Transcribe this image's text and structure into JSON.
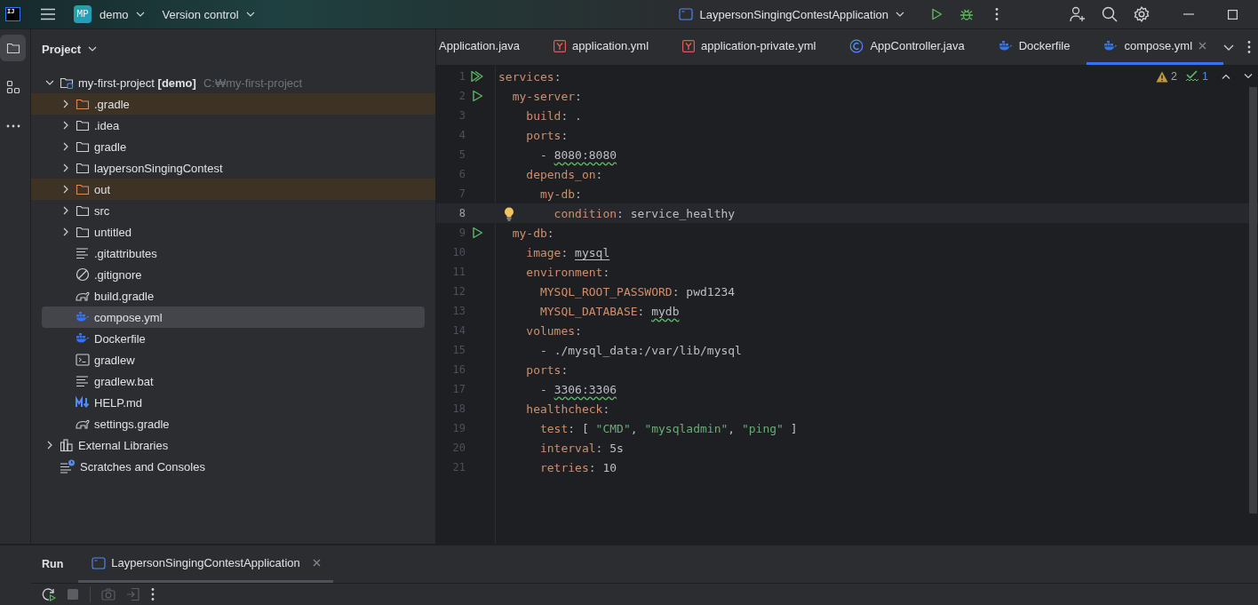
{
  "title_bar": {
    "app_logo": "IJ",
    "project_badge": "MP",
    "project_name": "demo",
    "vcs_menu": "Version control",
    "run_config": "LaypersonSingingContestApplication"
  },
  "tool_strip": [
    {
      "kind": "project",
      "selected": true
    },
    {
      "kind": "structure",
      "selected": false
    },
    {
      "kind": "more",
      "selected": false
    }
  ],
  "project_panel": {
    "title": "Project",
    "tree": [
      {
        "kind": "project",
        "label": "my-first-project **[demo]**",
        "path": "C:₩my-first-project",
        "expanded": true,
        "excluded": false,
        "selected": false,
        "children": [
          {
            "kind": "folder",
            "label": ".gradle",
            "expanded": false,
            "excluded": true,
            "selected": false
          },
          {
            "kind": "folder",
            "label": ".idea",
            "expanded": false,
            "excluded": false,
            "selected": false
          },
          {
            "kind": "folder",
            "label": "gradle",
            "expanded": false,
            "excluded": false,
            "selected": false
          },
          {
            "kind": "folder",
            "label": "laypersonSingingContest",
            "expanded": false,
            "excluded": false,
            "selected": false
          },
          {
            "kind": "folder",
            "label": "out",
            "expanded": false,
            "excluded": true,
            "selected": false
          },
          {
            "kind": "folder",
            "label": "src",
            "expanded": false,
            "excluded": false,
            "selected": false
          },
          {
            "kind": "folder",
            "label": "untitled",
            "expanded": false,
            "excluded": false,
            "selected": false
          },
          {
            "kind": "text",
            "label": ".gitattributes",
            "excluded": false,
            "selected": false
          },
          {
            "kind": "ignore",
            "label": ".gitignore",
            "excluded": false,
            "selected": false
          },
          {
            "kind": "gradle",
            "label": "build.gradle",
            "excluded": false,
            "selected": false
          },
          {
            "kind": "docker",
            "label": "compose.yml",
            "excluded": false,
            "selected": true
          },
          {
            "kind": "docker",
            "label": "Dockerfile",
            "excluded": false,
            "selected": false
          },
          {
            "kind": "terminal",
            "label": "gradlew",
            "excluded": false,
            "selected": false
          },
          {
            "kind": "text",
            "label": "gradlew.bat",
            "excluded": false,
            "selected": false
          },
          {
            "kind": "markdown",
            "label": "HELP.md",
            "excluded": false,
            "selected": false
          },
          {
            "kind": "gradle",
            "label": "settings.gradle",
            "excluded": false,
            "selected": false
          }
        ]
      },
      {
        "kind": "libraries",
        "label": "External Libraries",
        "expanded": false,
        "excluded": false,
        "selected": false
      },
      {
        "kind": "scratches",
        "label": "Scratches and Consoles",
        "excluded": false,
        "selected": false
      }
    ]
  },
  "editor_tabs": [
    {
      "kind": "none",
      "label": "Application.java",
      "selected": false
    },
    {
      "kind": "yaml",
      "label": "application.yml",
      "selected": false
    },
    {
      "kind": "yaml",
      "label": "application-private.yml",
      "selected": false
    },
    {
      "kind": "class",
      "label": "AppController.java",
      "selected": false
    },
    {
      "kind": "docker",
      "label": "Dockerfile",
      "selected": false
    },
    {
      "kind": "docker",
      "label": "compose.yml",
      "selected": true
    }
  ],
  "inspections": {
    "warnings": "2",
    "typos": "1"
  },
  "code": {
    "lines": [
      {
        "number": "1",
        "kind": "run_all",
        "current": false,
        "tokens": [
          {
            "kind": "key",
            "text": "services"
          },
          {
            "kind": "punct",
            "text": ":"
          }
        ]
      },
      {
        "number": "2",
        "kind": "run",
        "current": false,
        "tokens": [
          {
            "kind": "key",
            "text": "  my-server"
          },
          {
            "kind": "punct",
            "text": ":"
          }
        ]
      },
      {
        "number": "3",
        "kind": "plain",
        "current": false,
        "tokens": [
          {
            "kind": "key",
            "text": "    build"
          },
          {
            "kind": "punct",
            "text": ": ."
          }
        ]
      },
      {
        "number": "4",
        "kind": "plain",
        "current": false,
        "tokens": [
          {
            "kind": "key",
            "text": "    ports"
          },
          {
            "kind": "punct",
            "text": ":"
          }
        ]
      },
      {
        "number": "5",
        "kind": "plain",
        "current": false,
        "tokens": [
          {
            "kind": "punct",
            "text": "      - "
          },
          {
            "kind": "typo",
            "text": "8080:8080"
          }
        ]
      },
      {
        "number": "6",
        "kind": "plain",
        "current": false,
        "tokens": [
          {
            "kind": "key",
            "text": "    depends_on"
          },
          {
            "kind": "punct",
            "text": ":"
          }
        ]
      },
      {
        "number": "7",
        "kind": "plain",
        "current": false,
        "tokens": [
          {
            "kind": "key",
            "text": "      my-db"
          },
          {
            "kind": "punct",
            "text": ":"
          }
        ]
      },
      {
        "number": "8",
        "kind": "bulb",
        "current": true,
        "tokens": [
          {
            "kind": "key",
            "text": "        condition"
          },
          {
            "kind": "punct",
            "text": ": "
          },
          {
            "kind": "value",
            "text": "service_healthy"
          }
        ]
      },
      {
        "number": "9",
        "kind": "run",
        "current": false,
        "tokens": [
          {
            "kind": "key",
            "text": "  my-db"
          },
          {
            "kind": "punct",
            "text": ":"
          }
        ]
      },
      {
        "number": "10",
        "kind": "plain",
        "current": false,
        "tokens": [
          {
            "kind": "key",
            "text": "    image"
          },
          {
            "kind": "punct",
            "text": ": "
          },
          {
            "kind": "link",
            "text": "mysql"
          }
        ]
      },
      {
        "number": "11",
        "kind": "plain",
        "current": false,
        "tokens": [
          {
            "kind": "key",
            "text": "    environment"
          },
          {
            "kind": "punct",
            "text": ":"
          }
        ]
      },
      {
        "number": "12",
        "kind": "plain",
        "current": false,
        "tokens": [
          {
            "kind": "key",
            "text": "      MYSQL_ROOT_PASSWORD"
          },
          {
            "kind": "punct",
            "text": ": "
          },
          {
            "kind": "value",
            "text": "pwd1234"
          }
        ]
      },
      {
        "number": "13",
        "kind": "plain",
        "current": false,
        "tokens": [
          {
            "kind": "key",
            "text": "      MYSQL_DATABASE"
          },
          {
            "kind": "punct",
            "text": ": "
          },
          {
            "kind": "typo",
            "text": "mydb"
          }
        ]
      },
      {
        "number": "14",
        "kind": "plain",
        "current": false,
        "tokens": [
          {
            "kind": "key",
            "text": "    volumes"
          },
          {
            "kind": "punct",
            "text": ":"
          }
        ]
      },
      {
        "number": "15",
        "kind": "plain",
        "current": false,
        "tokens": [
          {
            "kind": "punct",
            "text": "      - "
          },
          {
            "kind": "value",
            "text": "./mysql_data:/var/lib/mysql"
          }
        ]
      },
      {
        "number": "16",
        "kind": "plain",
        "current": false,
        "tokens": [
          {
            "kind": "key",
            "text": "    ports"
          },
          {
            "kind": "punct",
            "text": ":"
          }
        ]
      },
      {
        "number": "17",
        "kind": "plain",
        "current": false,
        "tokens": [
          {
            "kind": "punct",
            "text": "      - "
          },
          {
            "kind": "typo",
            "text": "3306:3306"
          }
        ]
      },
      {
        "number": "18",
        "kind": "plain",
        "current": false,
        "tokens": [
          {
            "kind": "key",
            "text": "    healthcheck"
          },
          {
            "kind": "punct",
            "text": ":"
          }
        ]
      },
      {
        "number": "19",
        "kind": "plain",
        "current": false,
        "tokens": [
          {
            "kind": "key",
            "text": "      test"
          },
          {
            "kind": "punct",
            "text": ": [ "
          },
          {
            "kind": "string",
            "text": "\"CMD\""
          },
          {
            "kind": "punct",
            "text": ", "
          },
          {
            "kind": "string",
            "text": "\"mysqladmin\""
          },
          {
            "kind": "punct",
            "text": ", "
          },
          {
            "kind": "string",
            "text": "\"ping\""
          },
          {
            "kind": "punct",
            "text": " ]"
          }
        ]
      },
      {
        "number": "20",
        "kind": "plain",
        "current": false,
        "tokens": [
          {
            "kind": "key",
            "text": "      interval"
          },
          {
            "kind": "punct",
            "text": ": "
          },
          {
            "kind": "value",
            "text": "5s"
          }
        ]
      },
      {
        "number": "21",
        "kind": "plain",
        "current": false,
        "tokens": [
          {
            "kind": "key",
            "text": "      retries"
          },
          {
            "kind": "punct",
            "text": ": "
          },
          {
            "kind": "value",
            "text": "10"
          }
        ]
      }
    ]
  },
  "bottom_panel": {
    "title": "Run",
    "tabs": [
      {
        "label": "LaypersonSingingContestApplication",
        "selected": true
      }
    ]
  }
}
